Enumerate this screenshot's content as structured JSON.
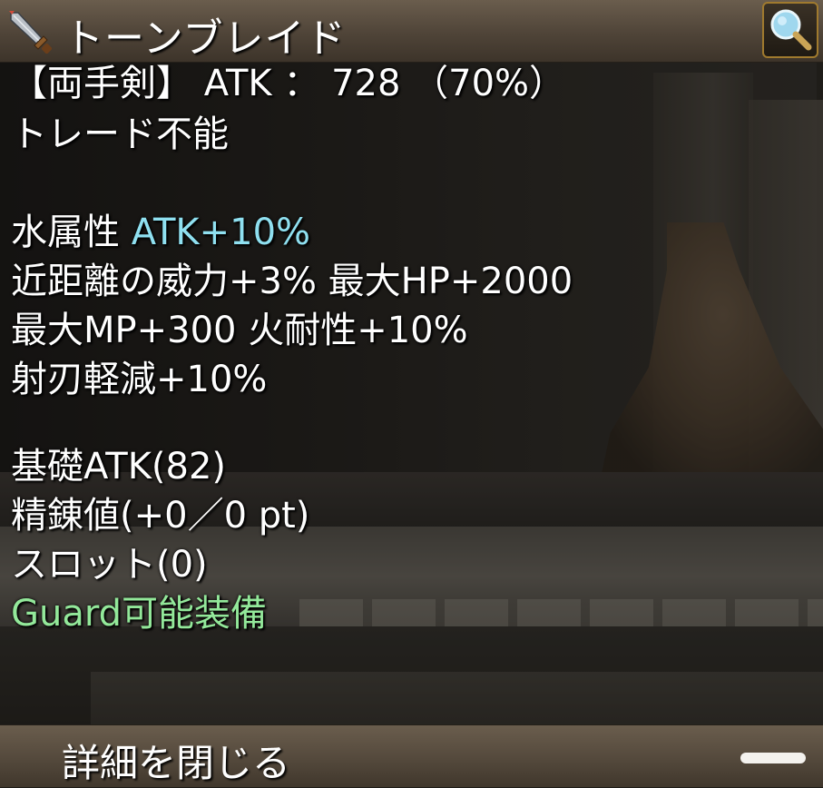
{
  "header": {
    "title": "トーンブレイド"
  },
  "icons": {
    "item": "sword-icon",
    "zoom": "magnifier-icon"
  },
  "details": {
    "weapon_type": "【両手剣】 ATK ： 728 （70%）",
    "trade": "トレード不能",
    "element_prefix": "水属性 ",
    "element_value": "ATK+10%",
    "stat_line_1": "近距離の威力+3% 最大HP+2000",
    "stat_line_2": "最大MP+300 火耐性+10%",
    "stat_line_3": "射刃軽減+10%",
    "base_atk": "基礎ATK(82)",
    "refine": "精錬値(+0／0 pt)",
    "slots": "スロット(0)",
    "guard": "Guard可能装備"
  },
  "footer": {
    "close_label": "詳細を閉じる"
  },
  "colors": {
    "text": "#ffffff",
    "element": "#8fe0f0",
    "guard": "#93e89a",
    "frame_gold": "#a07a2e"
  }
}
